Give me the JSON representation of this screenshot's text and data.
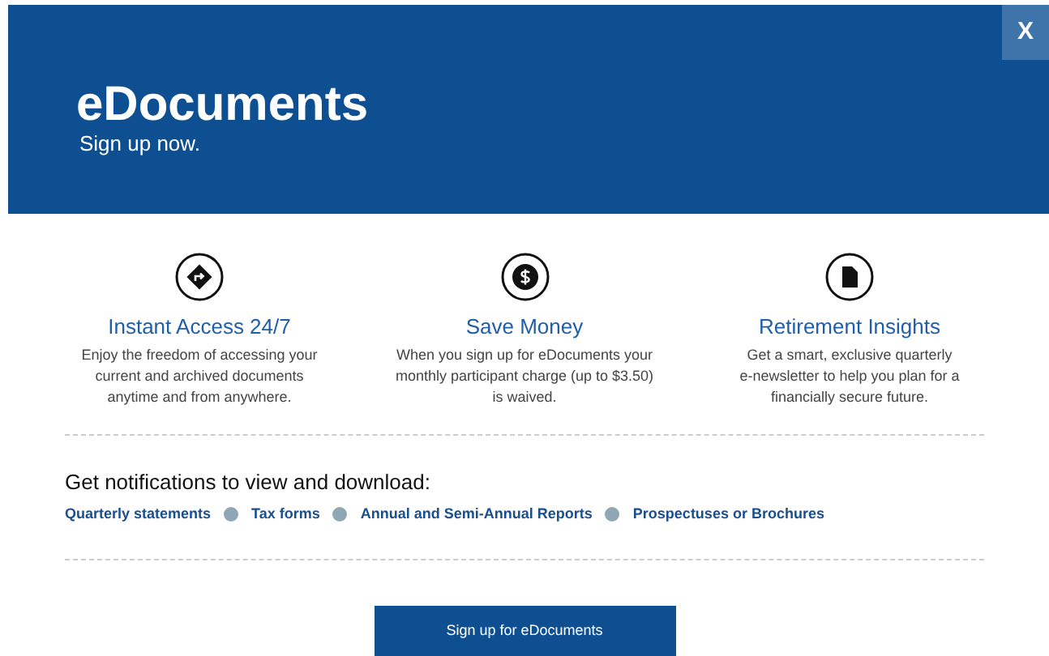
{
  "header": {
    "title": "eDocuments",
    "subtitle": "Sign up now.",
    "close": "X"
  },
  "features": [
    {
      "title": "Instant Access 24/7",
      "lines": [
        "Enjoy the freedom of accessing your",
        "current and archived documents",
        "anytime and from anywhere."
      ]
    },
    {
      "title": "Save Money",
      "lines": [
        "When you sign up for eDocuments your",
        "monthly participant charge (up to $3.50)",
        "is waived."
      ]
    },
    {
      "title": "Retirement Insights",
      "lines": [
        "Get a smart, exclusive quarterly",
        "e-newsletter to help you plan for a",
        "financially secure future."
      ]
    }
  ],
  "notifications": {
    "heading": "Get notifications to view and download:",
    "links": [
      "Quarterly statements",
      "Tax forms",
      "Annual and Semi-Annual Reports",
      "Prospectuses or Brochures"
    ]
  },
  "button": "Sign up for eDocuments"
}
